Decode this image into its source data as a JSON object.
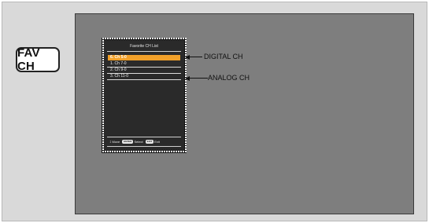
{
  "button": {
    "label": "FAV CH"
  },
  "osd": {
    "title": "Favorite CH List",
    "channels": [
      {
        "label": "6. Ch 5-0",
        "selected": true
      },
      {
        "label": "1. Ch 7-0",
        "selected": false
      },
      {
        "label": "2. Ch 9-0",
        "selected": false
      },
      {
        "label": "3. Ch 11-0",
        "selected": false
      }
    ],
    "footer": {
      "move_label": "Move",
      "select_key": "ENTER",
      "select_label": "Select",
      "exit_key": "EXIT",
      "exit_label": "Exit"
    }
  },
  "callouts": {
    "digital": "DIGITAL CH",
    "analog": "ANALOG CH"
  },
  "colors": {
    "screen_bg": "#7e7e7e",
    "selected": "#f2a12a",
    "osd_bg": "#2a2a2a"
  }
}
